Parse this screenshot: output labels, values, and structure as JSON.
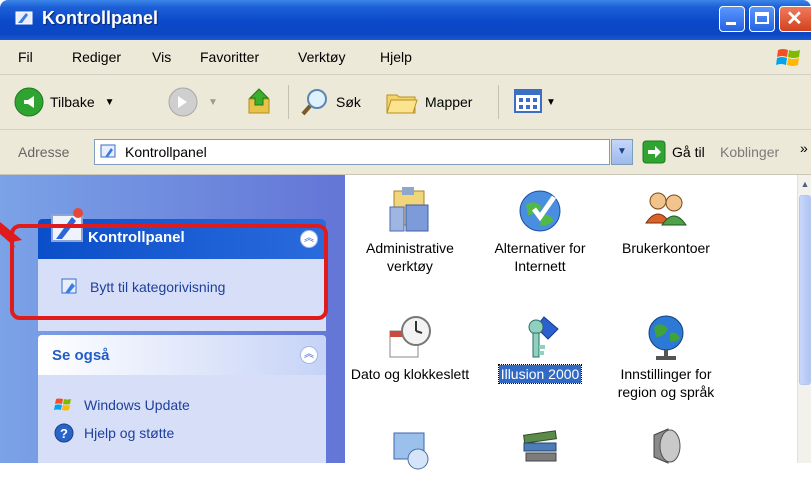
{
  "window": {
    "title": "Kontrollpanel"
  },
  "menu": [
    "Fil",
    "Rediger",
    "Vis",
    "Favoritter",
    "Verktøy",
    "Hjelp"
  ],
  "toolbar": {
    "back": "Tilbake",
    "search": "Søk",
    "folders": "Mapper"
  },
  "address": {
    "label": "Adresse",
    "value": "Kontrollpanel",
    "go": "Gå til",
    "links": "Koblinger",
    "chevron": "»"
  },
  "tasks": {
    "title": "Kontrollpanel",
    "switch_view": "Bytt til kategorivisning"
  },
  "see_also": {
    "title": "Se også",
    "items": [
      "Windows Update",
      "Hjelp og støtte"
    ]
  },
  "icons": [
    {
      "label": "Administrative verktøy",
      "icon": "admin-tools-icon"
    },
    {
      "label": "Alternativer for Internett",
      "icon": "internet-options-icon"
    },
    {
      "label": "Brukerkontoer",
      "icon": "user-accounts-icon"
    },
    {
      "label": "Dato og klokkeslett",
      "icon": "date-time-icon"
    },
    {
      "label": "Illusion 2000",
      "icon": "illusion-key-icon",
      "selected": true
    },
    {
      "label": "Innstillinger for region og språk",
      "icon": "regional-globe-icon"
    }
  ],
  "colors": {
    "highlight": "#e01b1b",
    "titlebar": "#0a49c9",
    "selection": "#316ac5"
  }
}
